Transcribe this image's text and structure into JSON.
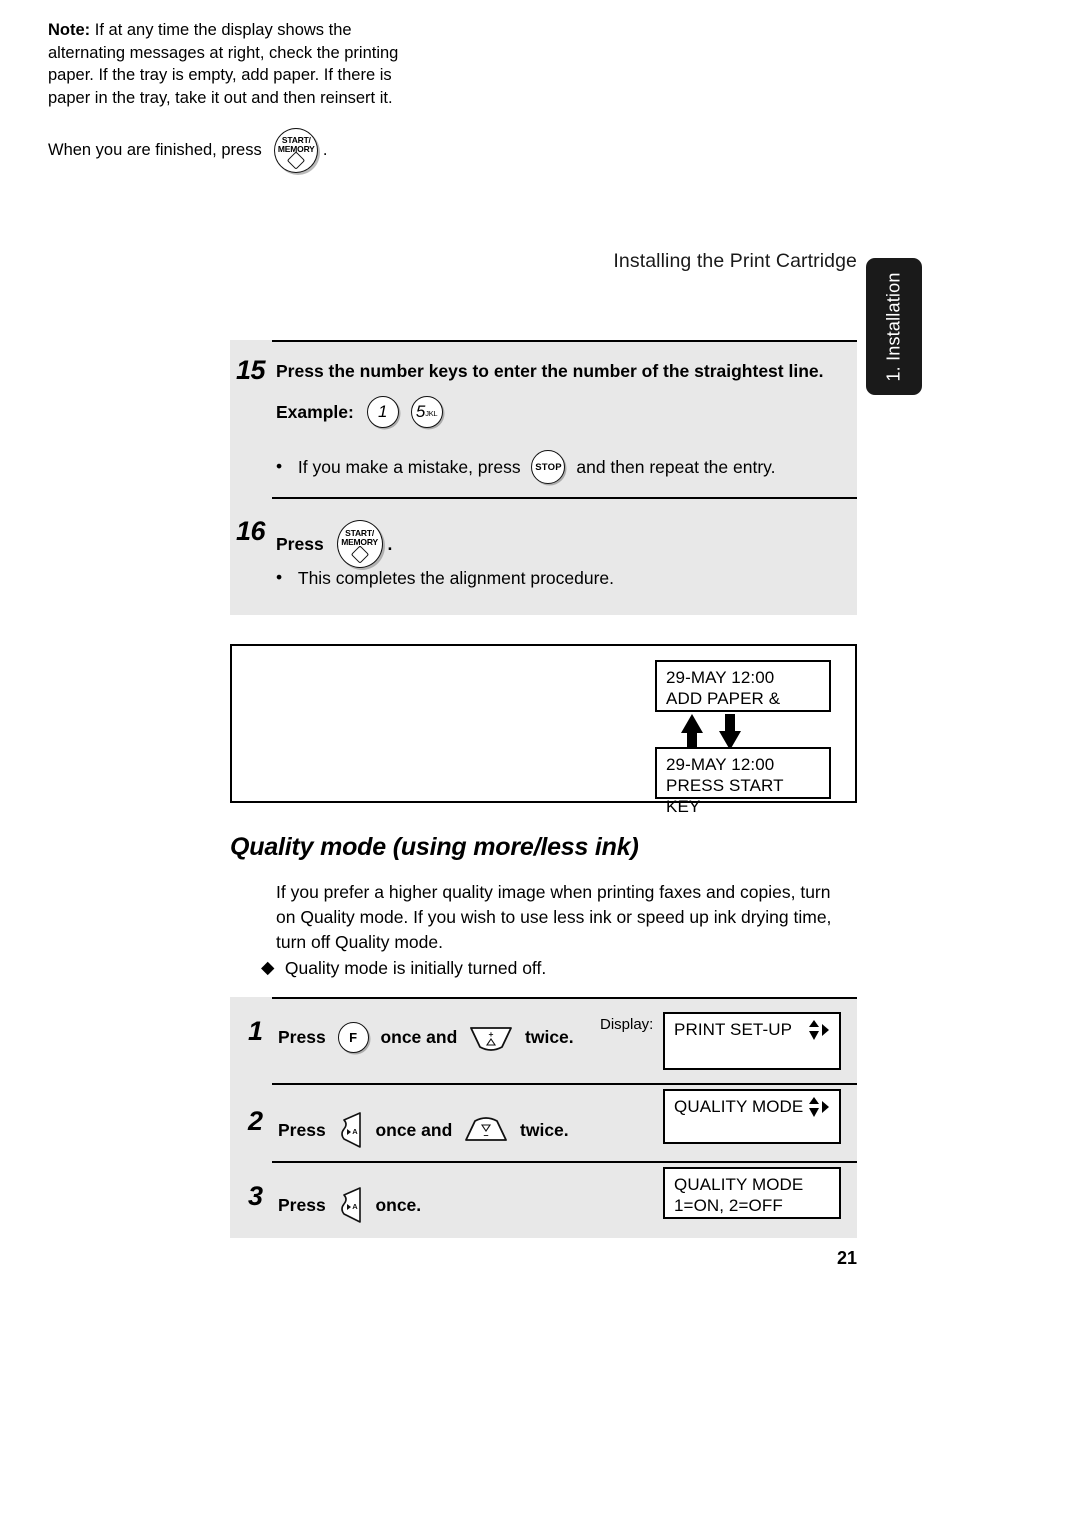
{
  "header": {
    "running_title": "Installing the Print Cartridge"
  },
  "side_tab": {
    "label": "1. Installation"
  },
  "steps_top": [
    {
      "number": "15",
      "text": "Press the number keys to enter the number of the straightest line.",
      "example_label": "Example:",
      "example_keys": [
        {
          "digit": "1",
          "letters": ""
        },
        {
          "digit": "5",
          "letters": "JKL"
        }
      ],
      "bullet_before": "If you make a mistake, press",
      "bullet_key": "STOP",
      "bullet_after": "and then repeat the entry."
    },
    {
      "number": "16",
      "press_label": "Press",
      "key_line1": "START/",
      "key_line2": "MEMORY",
      "period": ".",
      "bullet": "This completes the alignment procedure."
    }
  ],
  "note": {
    "label": "Note:",
    "body": "If at any time the display shows the alternating messages at right, check the printing paper. If the tray is empty, add paper. If there is paper in the tray, take it out and then reinsert it.",
    "finish_before": "When you are finished, press",
    "finish_key_line1": "START/",
    "finish_key_line2": "MEMORY",
    "finish_after": ".",
    "display_top": {
      "line1": "29-MAY 12:00",
      "line2": "ADD PAPER &"
    },
    "display_bottom": {
      "line1": "29-MAY 12:00",
      "line2": "PRESS START KEY"
    }
  },
  "section": {
    "heading": "Quality mode (using more/less ink)",
    "paragraph": "If you prefer a higher quality image when printing faxes and copies, turn on Quality mode. If you wish to use less ink or speed up ink drying time, turn off Quality mode.",
    "bullet": "Quality mode is initially turned off."
  },
  "display_label": "Display:",
  "steps_bottom": [
    {
      "number": "1",
      "press": "Press",
      "key1": "F",
      "mid": "once and",
      "key2": "up-contrast-key",
      "end": "twice.",
      "lcd_line1": "PRINT SET-UP",
      "lcd_line2": "",
      "lcd_arrows": true
    },
    {
      "number": "2",
      "press": "Press",
      "key1": "page-feed-key",
      "mid": "once and",
      "key2": "down-contrast-key",
      "end": "twice.",
      "lcd_line1": "QUALITY MODE",
      "lcd_line2": "",
      "lcd_arrows": true
    },
    {
      "number": "3",
      "press": "Press",
      "key1": "page-feed-key",
      "mid": "",
      "key2": "",
      "end": "once.",
      "lcd_line1": "QUALITY MODE",
      "lcd_line2": "1=ON, 2=OFF",
      "lcd_arrows": false
    }
  ],
  "page_number": "21",
  "colors": {
    "panel_grey": "#e8e8e8",
    "tab_black": "#1a1a1a",
    "ink": "#000000"
  }
}
